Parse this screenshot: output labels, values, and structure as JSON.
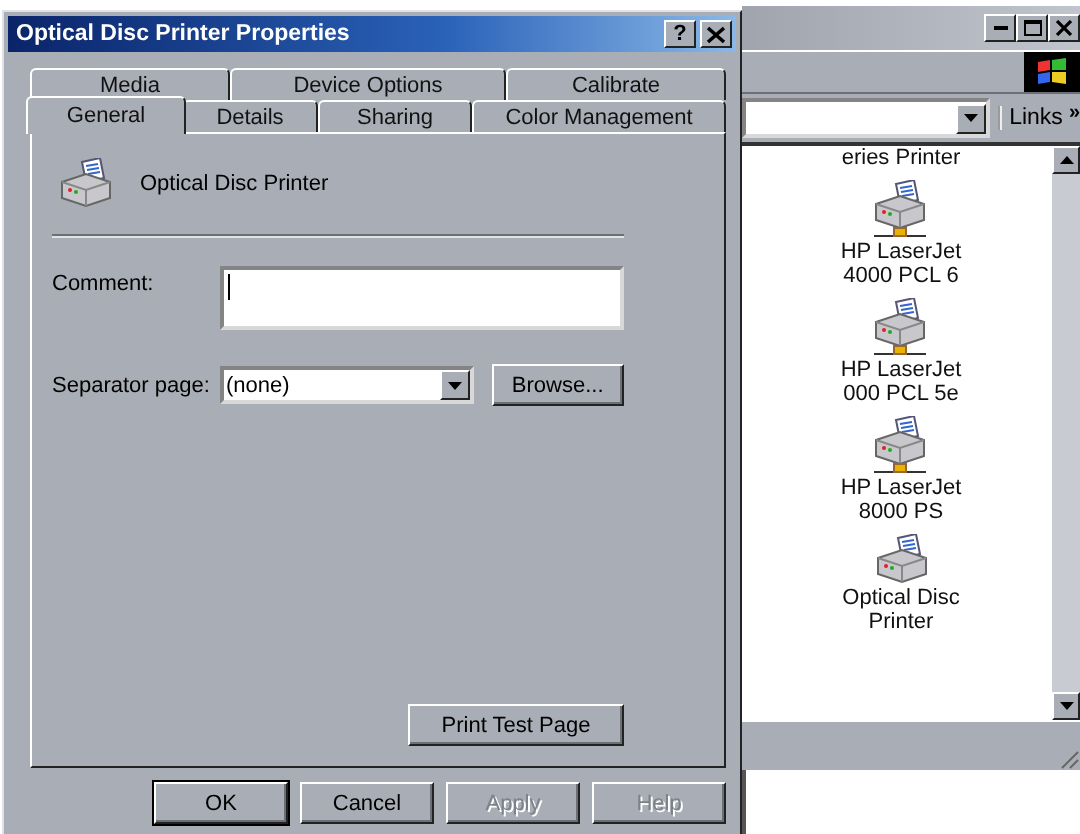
{
  "dialog": {
    "title": "Optical Disc Printer Properties",
    "help_button": "?",
    "tab_rows": [
      [
        {
          "label": "Media",
          "selected": false
        },
        {
          "label": "Device Options",
          "selected": false
        },
        {
          "label": "Calibrate",
          "selected": false
        }
      ],
      [
        {
          "label": "General",
          "selected": true
        },
        {
          "label": "Details",
          "selected": false
        },
        {
          "label": "Sharing",
          "selected": false
        },
        {
          "label": "Color Management",
          "selected": false
        }
      ]
    ],
    "printer_name": "Optical Disc Printer",
    "comment": {
      "label": "Comment:"
    },
    "separator": {
      "label": "Separator page:",
      "value": "(none)"
    },
    "browse_button": {
      "label": "Browse..."
    },
    "test_button": {
      "label": "Print Test Page"
    },
    "buttons": [
      {
        "label": "OK",
        "default": true,
        "disabled": false
      },
      {
        "label": "Cancel",
        "default": false,
        "disabled": false
      },
      {
        "label": "Apply",
        "default": false,
        "disabled": true
      },
      {
        "label": "Help",
        "default": false,
        "disabled": true
      }
    ]
  },
  "explorer": {
    "links": "Links",
    "chevron": "»",
    "items": [
      {
        "kind": "label",
        "lines": [
          "eries Printer"
        ]
      },
      {
        "kind": "shared",
        "lines": [
          "HP LaserJet",
          "4000 PCL 6"
        ]
      },
      {
        "kind": "shared",
        "lines": [
          "HP LaserJet",
          "000 PCL 5e"
        ]
      },
      {
        "kind": "shared",
        "lines": [
          "HP LaserJet",
          "8000 PS"
        ]
      },
      {
        "kind": "local",
        "lines": [
          "Optical Disc",
          "Printer"
        ]
      }
    ]
  }
}
